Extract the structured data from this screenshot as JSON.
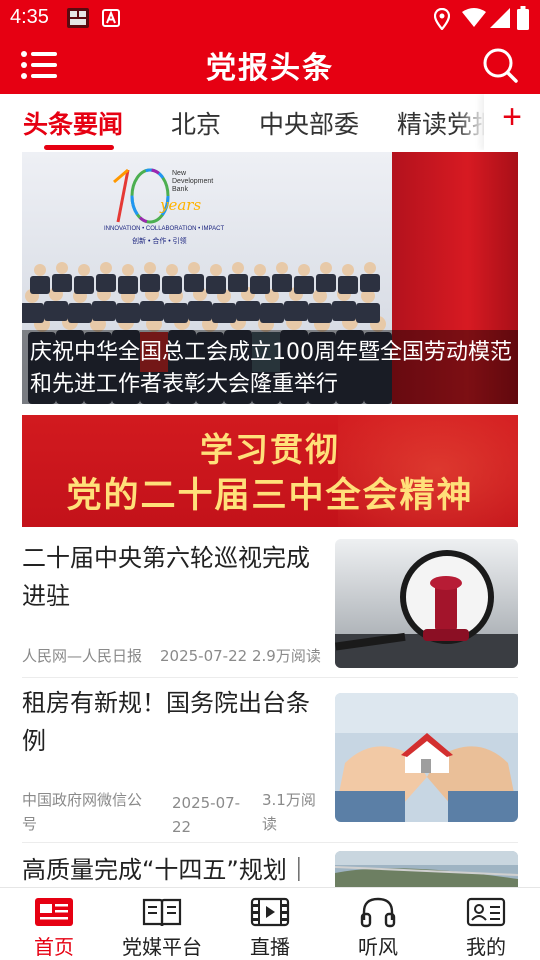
{
  "status_bar": {
    "time": "4:35"
  },
  "header": {
    "title": "党报头条"
  },
  "tabs": [
    {
      "label": "头条要闻",
      "active": true
    },
    {
      "label": "北京",
      "active": false
    },
    {
      "label": "中央部委",
      "active": false
    },
    {
      "label": "精读党报",
      "active": false
    }
  ],
  "tab_add_label": "+",
  "hero": {
    "logo_line1": "New",
    "logo_line2": "Development",
    "logo_line3": "Bank",
    "logo_years": "years",
    "logo_tagline": "INNOVATION • COLLABORATION • IMPACT",
    "logo_tagline_cn": "创新 • 合作 • 引领",
    "caption": "庆祝中华全国总工会成立100周年暨全国劳动模范和先进工作者表彰大会隆重举行"
  },
  "banner": {
    "line1": "学习贯彻",
    "line2": "党的二十届三中全会精神"
  },
  "articles": [
    {
      "headline": "二十届中央第六轮巡视完成进驻",
      "source": "人民网—人民日报",
      "date": "2025-07-22",
      "reads": "2.9万阅读"
    },
    {
      "headline": "租房有新规！国务院出台条例",
      "source": "中国政府网微信公号",
      "date": "2025-07-22",
      "reads": "3.1万阅读"
    },
    {
      "headline": "高质量完成“十四五”规划｜"
    }
  ],
  "bottom_nav": [
    {
      "label": "首页",
      "icon": "newspaper-icon",
      "active": true
    },
    {
      "label": "党媒平台",
      "icon": "book-icon",
      "active": false
    },
    {
      "label": "直播",
      "icon": "film-play-icon",
      "active": false
    },
    {
      "label": "听风",
      "icon": "headphones-icon",
      "active": false
    },
    {
      "label": "我的",
      "icon": "profile-card-icon",
      "active": false
    }
  ],
  "colors": {
    "brand_red": "#e60012",
    "banner_text": "#ffe07a"
  }
}
